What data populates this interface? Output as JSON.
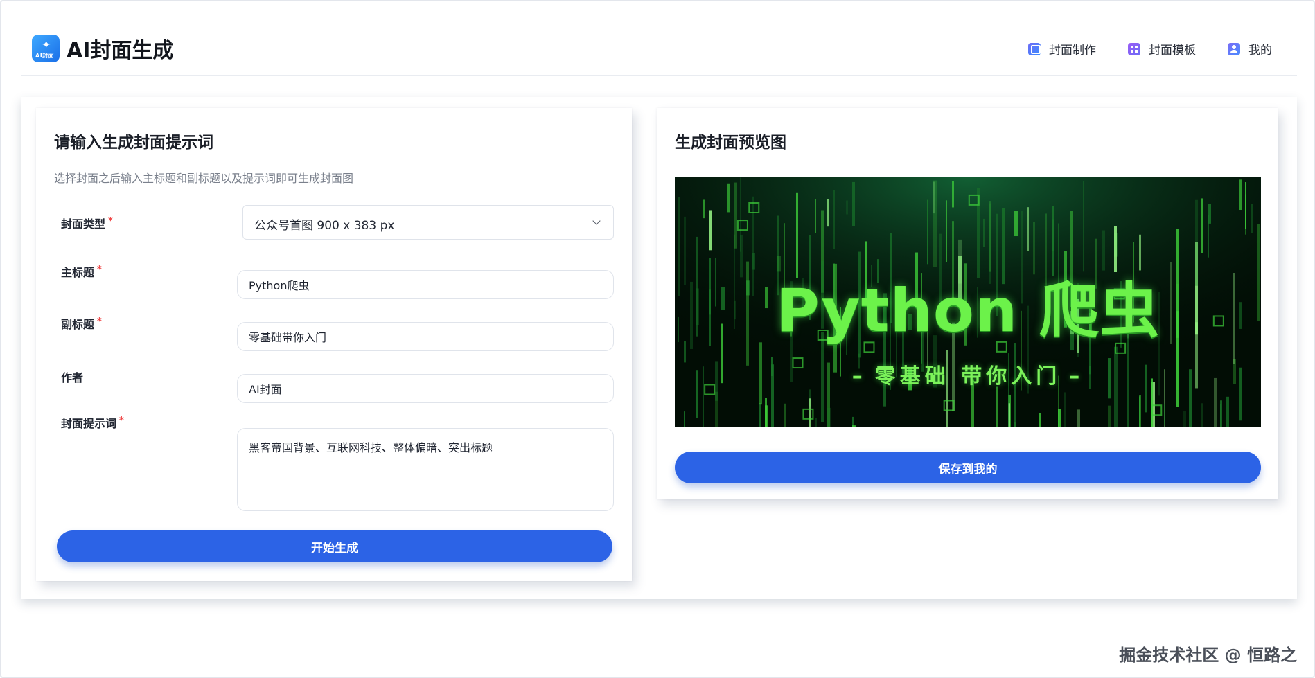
{
  "header": {
    "logo_text": "AI封面",
    "app_title": "AI封面生成",
    "nav": [
      {
        "label": "封面制作",
        "icon": "image-frame-icon"
      },
      {
        "label": "封面模板",
        "icon": "grid-template-icon"
      },
      {
        "label": "我的",
        "icon": "user-icon"
      }
    ]
  },
  "form_card": {
    "title": "请输入生成封面提示词",
    "description": "选择封面之后输入主标题和副标题以及提示词即可生成封面图",
    "cover_type_label": "封面类型",
    "cover_type_value": "公众号首图 900 x 383 px",
    "main_title_label": "主标题",
    "main_title_value": "Python爬虫",
    "subtitle_label": "副标题",
    "subtitle_value": "零基础带你入门",
    "author_label": "作者",
    "author_value": "AI封面",
    "prompt_label": "封面提示词",
    "prompt_value": "黑客帝国背景、互联网科技、整体偏暗、突出标题",
    "required_mark": "*",
    "generate_button": "开始生成"
  },
  "preview_card": {
    "title": "生成封面预览图",
    "image_title": "Python 爬虫",
    "image_subtitle": "零基础 带你入门",
    "image_dash": "–",
    "save_button": "保存到我的"
  },
  "watermark": "掘金技术社区 @ 恒路之",
  "colors": {
    "primary": "#2c63e6",
    "required": "#f04747",
    "preview_green": "#6cf24a",
    "preview_bg": "#020d05"
  }
}
